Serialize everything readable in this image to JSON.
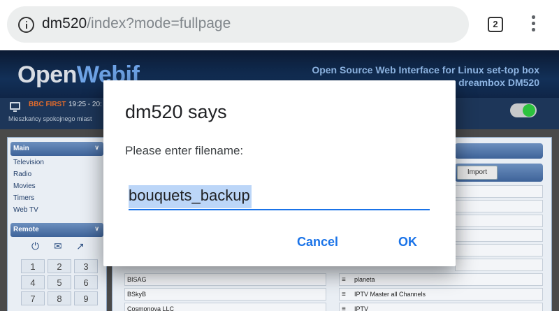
{
  "browser": {
    "url_host": "dm520",
    "url_path": "/index?mode=fullpage",
    "tab_count": "2"
  },
  "webif": {
    "logo_open": "Open",
    "logo_webif": "Webif",
    "tagline_1": "Open Source Web Interface for Linux set-top box",
    "tagline_2": "dreambox DM520",
    "channel": "BBC FIRST",
    "time": "19:25 - 20:",
    "event": "Mieszkańcy spokojnego miast",
    "main_panel": "Main",
    "main_items": [
      "Television",
      "Radio",
      "Movies",
      "Timers",
      "Web TV"
    ],
    "remote_panel": "Remote",
    "keypad": [
      "1",
      "2",
      "3",
      "4",
      "5",
      "6",
      "7",
      "8",
      "9"
    ],
    "import_label": "Import",
    "left_list": [
      "BISAG",
      "BSkyB",
      "Cosmonova LLC"
    ],
    "right_list": [
      "planeta",
      "IPTV Master all Channels",
      "IPTV"
    ]
  },
  "dialog": {
    "title": "dm520 says",
    "message": "Please enter filename:",
    "input_value": "bouquets_backup",
    "cancel_label": "Cancel",
    "ok_label": "OK"
  },
  "colors": {
    "accent": "#1a73e8",
    "selection": "#bcd6f8",
    "header_bg": "#123058"
  }
}
